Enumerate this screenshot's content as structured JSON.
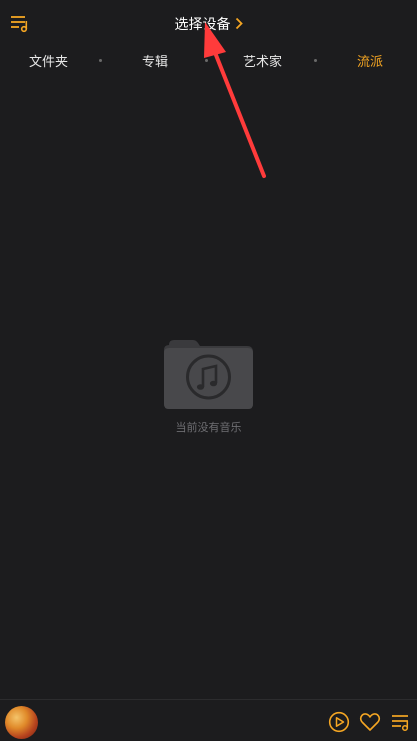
{
  "header": {
    "title": "选择设备",
    "title_chevron_icon": "chevron-right-icon",
    "playlist_icon": "music-list-icon"
  },
  "tabs": [
    {
      "label": "文件夹",
      "active": false
    },
    {
      "label": "专辑",
      "active": false
    },
    {
      "label": "艺术家",
      "active": false
    },
    {
      "label": "流派",
      "active": true
    }
  ],
  "empty_state": {
    "icon": "music-folder-icon",
    "text": "当前没有音乐"
  },
  "bottom_bar": {
    "avatar": "album-art",
    "icons": [
      "play-icon",
      "heart-icon",
      "queue-list-icon"
    ]
  },
  "colors": {
    "background": "#1c1c1e",
    "accent": "#f5a623",
    "annotation_arrow": "#ff3b3b"
  }
}
